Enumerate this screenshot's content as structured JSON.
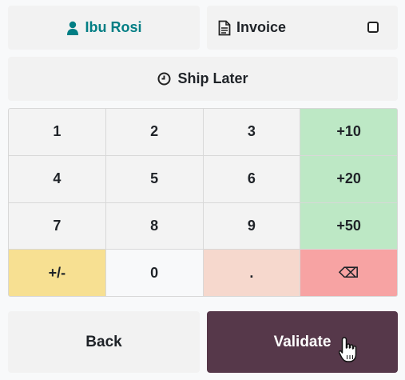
{
  "customer": {
    "name": "Ibu Rosi",
    "icon": "user-icon",
    "color": "#017e84"
  },
  "invoice": {
    "label": "Invoice",
    "icon": "document-icon",
    "checked": false
  },
  "ship_later": {
    "label": "Ship Later",
    "icon": "clock-icon"
  },
  "numpad": {
    "keys": [
      "1",
      "2",
      "3",
      "+10",
      "4",
      "5",
      "6",
      "+20",
      "7",
      "8",
      "9",
      "+50",
      "+/-",
      "0",
      ".",
      "⌫"
    ]
  },
  "actions": {
    "back_label": "Back",
    "validate_label": "Validate",
    "validate_color": "#56384a"
  }
}
